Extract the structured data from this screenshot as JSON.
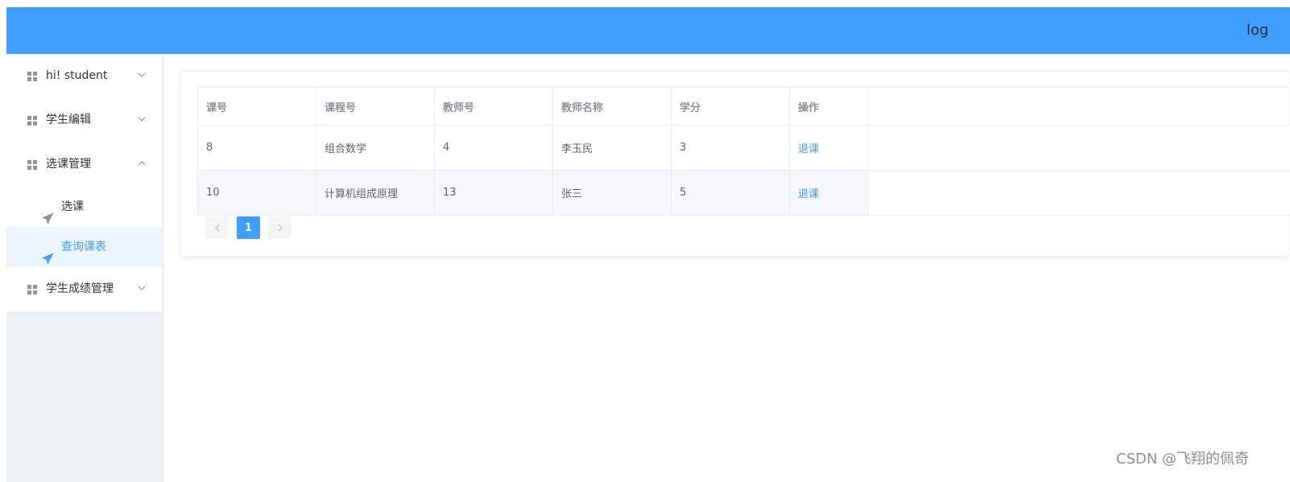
{
  "header": {
    "logout_label": "log"
  },
  "sidebar": {
    "menus": [
      {
        "label": "hi! student",
        "expanded": false
      },
      {
        "label": "学生编辑",
        "expanded": false
      },
      {
        "label": "选课管理",
        "expanded": true,
        "children": [
          {
            "label": "选课",
            "active": false
          },
          {
            "label": "查询课表",
            "active": true
          }
        ]
      },
      {
        "label": "学生成绩管理",
        "expanded": false
      }
    ]
  },
  "table": {
    "columns": [
      "课号",
      "课程号",
      "教师号",
      "教师名称",
      "学分",
      "操作"
    ],
    "rows": [
      {
        "course_id": "8",
        "course_name": "组合数学",
        "teacher_id": "4",
        "teacher_name": "李玉民",
        "credit": "3",
        "action": "退课"
      },
      {
        "course_id": "10",
        "course_name": "计算机组成原理",
        "teacher_id": "13",
        "teacher_name": "张三",
        "credit": "5",
        "action": "退课"
      }
    ]
  },
  "pagination": {
    "current_page": "1",
    "prev_icon": "chevron-left-icon",
    "next_icon": "chevron-right-icon"
  },
  "watermark": "CSDN @飞翔的佩奇",
  "colors": {
    "primary": "#409eff",
    "sidebar_bg": "#edf1f6",
    "active_bg": "#ecf5ff"
  }
}
